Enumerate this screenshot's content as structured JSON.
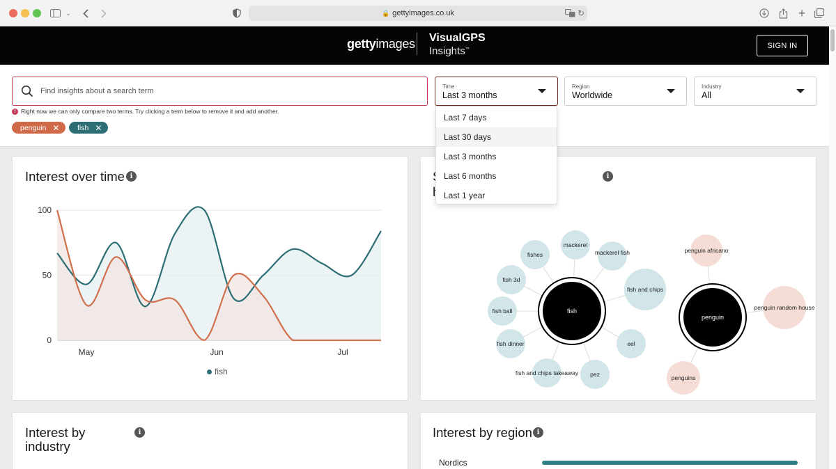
{
  "browser": {
    "url": "gettyimages.co.uk"
  },
  "header": {
    "brand_bold": "getty",
    "brand_light": "images",
    "product_top": "VisualGPS",
    "product_bottom": "Insights",
    "tm": "™",
    "sign_in": "SIGN IN"
  },
  "search": {
    "placeholder": "Find insights about a search term",
    "warning": "Right now we can only compare two terms. Try clicking a term below to remove it and add another."
  },
  "chips": [
    {
      "label": "penguin",
      "color": "#cf6948"
    },
    {
      "label": "fish",
      "color": "#2d6e75"
    }
  ],
  "filters": {
    "time": {
      "label": "Time",
      "value": "Last 3 months"
    },
    "region": {
      "label": "Region",
      "value": "Worldwide"
    },
    "industry": {
      "label": "Industry",
      "value": "All"
    }
  },
  "time_menu": {
    "options": [
      "Last 7 days",
      "Last 30 days",
      "Last 3 months",
      "Last 6 months",
      "Last 1 year"
    ],
    "hovered": "Last 30 days"
  },
  "interest_over_time": {
    "title": "Interest over time",
    "legend": "fish",
    "y_ticks": [
      "100",
      "50",
      "0"
    ],
    "x_ticks": [
      "May",
      "Jun",
      "Jul"
    ]
  },
  "chart_data": {
    "type": "area",
    "ylim": [
      0,
      100
    ],
    "x_tick_labels": [
      "May",
      "Jun",
      "Jul"
    ],
    "series": [
      {
        "name": "fish",
        "color": "#2d6e75",
        "values": [
          67,
          43,
          75,
          26,
          82,
          100,
          32,
          50,
          70,
          59,
          50,
          84
        ]
      },
      {
        "name": "",
        "color": "#d0704d",
        "values": [
          100,
          27,
          64,
          31,
          31,
          0,
          50,
          34,
          0,
          0,
          0,
          0
        ]
      }
    ]
  },
  "related": {
    "title_char_1": "S",
    "title_char_2": "h",
    "fish_center": "fish",
    "penguin_center": "penguin",
    "fish_terms": [
      "fishes",
      "mackerel",
      "mackerel fish",
      "fish 3d",
      "fish and chips",
      "fish ball",
      "eel",
      "fish dinner",
      "fish and chips takeaway",
      "pez"
    ],
    "penguin_terms": [
      "penguin africano",
      "penguin random house",
      "penguins"
    ],
    "fish_color": "#d2e6ea",
    "penguin_color": "#f5ddd5"
  },
  "interest_by_industry": {
    "title_line1": "Interest by",
    "title_line2": "industry"
  },
  "interest_by_region": {
    "title": "Interest by region",
    "first_row_label": "Nordics",
    "first_row_value": 100
  }
}
